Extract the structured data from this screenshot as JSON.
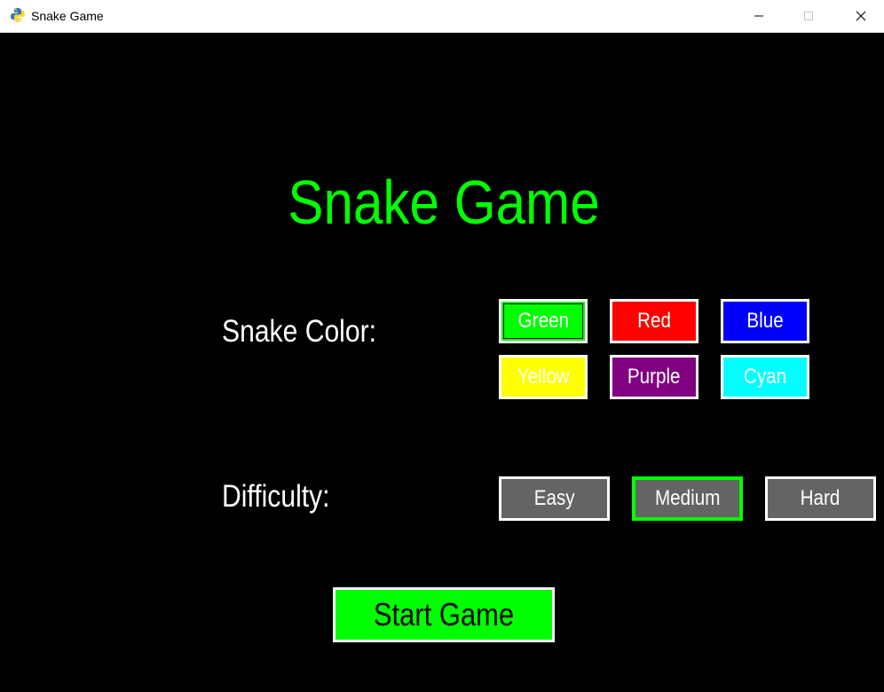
{
  "window": {
    "title": "Snake Game",
    "icon": "python-pygame-icon"
  },
  "game": {
    "title": "Snake Game",
    "snake_color_label": "Snake Color:",
    "difficulty_label": "Difficulty:",
    "start_label": "Start Game",
    "colors": [
      {
        "label": "Green",
        "bg": "#00ff00",
        "selected": true
      },
      {
        "label": "Red",
        "bg": "#ff0000",
        "selected": false
      },
      {
        "label": "Blue",
        "bg": "#0000ff",
        "selected": false
      },
      {
        "label": "Yellow",
        "bg": "#ffff00",
        "selected": false
      },
      {
        "label": "Purple",
        "bg": "#800080",
        "selected": false
      },
      {
        "label": "Cyan",
        "bg": "#00ffff",
        "selected": false
      }
    ],
    "difficulties": [
      {
        "label": "Easy",
        "selected": false
      },
      {
        "label": "Medium",
        "selected": true
      },
      {
        "label": "Hard",
        "selected": false
      }
    ],
    "accent_color": "#00ff00",
    "button_gray": "#646464"
  }
}
